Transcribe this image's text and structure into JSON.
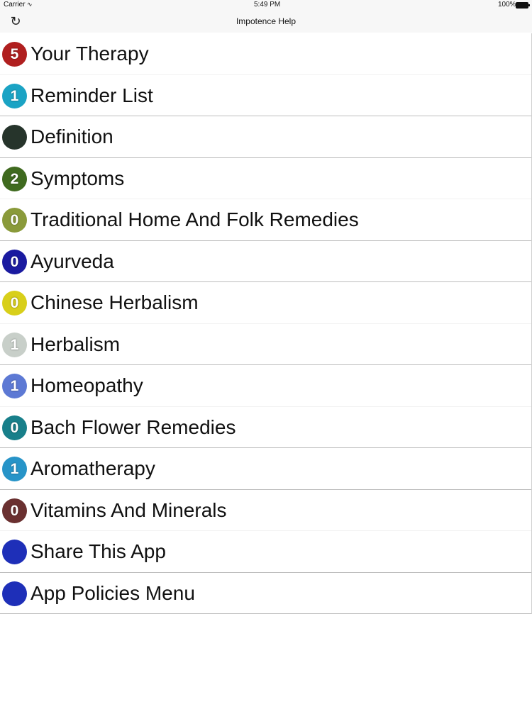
{
  "status_bar": {
    "carrier": "Carrier",
    "time": "5:49 PM",
    "battery": "100%"
  },
  "nav": {
    "title": "Impotence Help"
  },
  "items": [
    {
      "label": "Your Therapy",
      "count": "5",
      "color": "#b01f1f"
    },
    {
      "label": "Reminder List",
      "count": "1",
      "color": "#1ba3c4"
    },
    {
      "label": "Definition",
      "count": "",
      "color": "#26342b"
    },
    {
      "label": "Symptoms",
      "count": "2",
      "color": "#3f6a1f"
    },
    {
      "label": "Traditional Home And Folk Remedies",
      "count": "0",
      "color": "#8a9a3a"
    },
    {
      "label": "Ayurveda",
      "count": "0",
      "color": "#1a1aa0"
    },
    {
      "label": "Chinese Herbalism",
      "count": "0",
      "color": "#d8cf1a"
    },
    {
      "label": "Herbalism",
      "count": "1",
      "color": "#c8cfc9"
    },
    {
      "label": "Homeopathy",
      "count": "1",
      "color": "#5d79d4"
    },
    {
      "label": "Bach Flower Remedies",
      "count": "0",
      "color": "#187f8a"
    },
    {
      "label": "Aromatherapy",
      "count": "1",
      "color": "#2794c8"
    },
    {
      "label": "Vitamins And Minerals",
      "count": "0",
      "color": "#6a3030"
    },
    {
      "label": "Share This App",
      "count": "",
      "color": "#1e2fb8"
    },
    {
      "label": "App Policies Menu",
      "count": "",
      "color": "#1e2fb8"
    }
  ]
}
